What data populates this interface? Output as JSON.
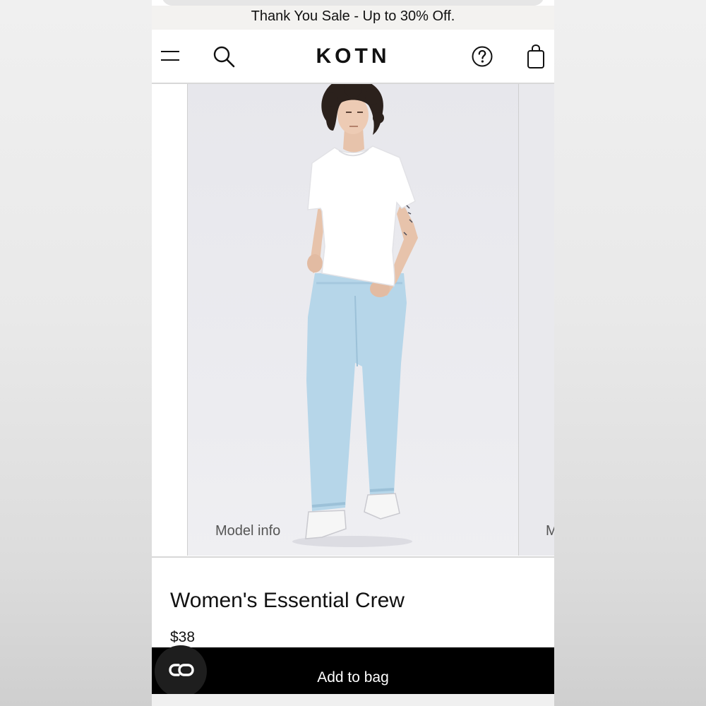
{
  "announcement": {
    "text": "Thank You Sale - Up to 30% Off."
  },
  "header": {
    "logo": "KOTN",
    "menu_icon": "hamburger-menu-icon",
    "search_icon": "search-icon",
    "help_icon": "question-circle-icon",
    "bag_icon": "shopping-bag-icon"
  },
  "gallery": {
    "model_info_label": "Model info",
    "next_model_info_label": "M",
    "image": "model-wearing-white-tee-and-light-wash-jeans"
  },
  "product": {
    "name": "Women's Essential Crew",
    "price": "$38"
  },
  "actions": {
    "add_to_bag": "Add to bag",
    "chat_icon": "chat-link-icon"
  },
  "colors": {
    "brand_text": "#111111",
    "cta_background": "#000000",
    "cta_text": "#ffffff",
    "announcement_bg": "#f3f2f0"
  }
}
